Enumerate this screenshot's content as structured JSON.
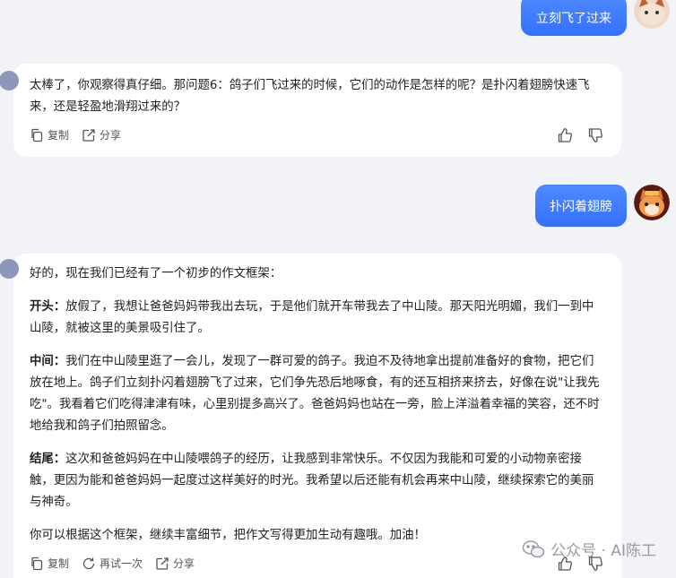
{
  "messages": {
    "user1": {
      "text": "立刻飞了过来"
    },
    "bot1": {
      "text": "太棒了，你观察得真仔细。那问题6：鸽子们飞过来的时候，它们的动作是怎样的呢？是扑闪着翅膀快速飞来，还是轻盈地滑翔过来的？",
      "copy_label": "复制",
      "share_label": "分享"
    },
    "user2": {
      "text": "扑闪着翅膀"
    },
    "bot2": {
      "intro": "好的，现在我们已经有了一个初步的作文框架：",
      "sections": [
        {
          "label": "开头：",
          "text": "放假了，我想让爸爸妈妈带我出去玩，于是他们就开车带我去了中山陵。那天阳光明媚，我们一到中山陵，就被这里的美景吸引住了。"
        },
        {
          "label": "中间：",
          "text": "我们在中山陵里逛了一会儿，发现了一群可爱的鸽子。我迫不及待地拿出提前准备好的食物，把它们放在地上。鸽子们立刻扑闪着翅膀飞了过来，它们争先恐后地啄食，有的还互相挤来挤去，好像在说\"让我先吃\"。我看着它们吃得津津有味，心里别提多高兴了。爸爸妈妈也站在一旁，脸上洋溢着幸福的笑容，还不时地给我和鸽子们拍照留念。"
        },
        {
          "label": "结尾：",
          "text": "这次和爸爸妈妈在中山陵喂鸽子的经历，让我感到非常快乐。不仅因为我能和可爱的小动物亲密接触，更因为能和爸爸妈妈一起度过这样美好的时光。我希望以后还能有机会再来中山陵，继续探索它的美丽与神奇。"
        }
      ],
      "outro": "你可以根据这个框架，继续丰富细节，把作文写得更加生动有趣哦。加油！",
      "copy_label": "复制",
      "retry_label": "再试一次",
      "share_label": "分享"
    }
  },
  "watermark": {
    "text": "公众号 · AI陈工"
  },
  "colors": {
    "accent": "#3370ff",
    "background": "#f2f3f7"
  }
}
